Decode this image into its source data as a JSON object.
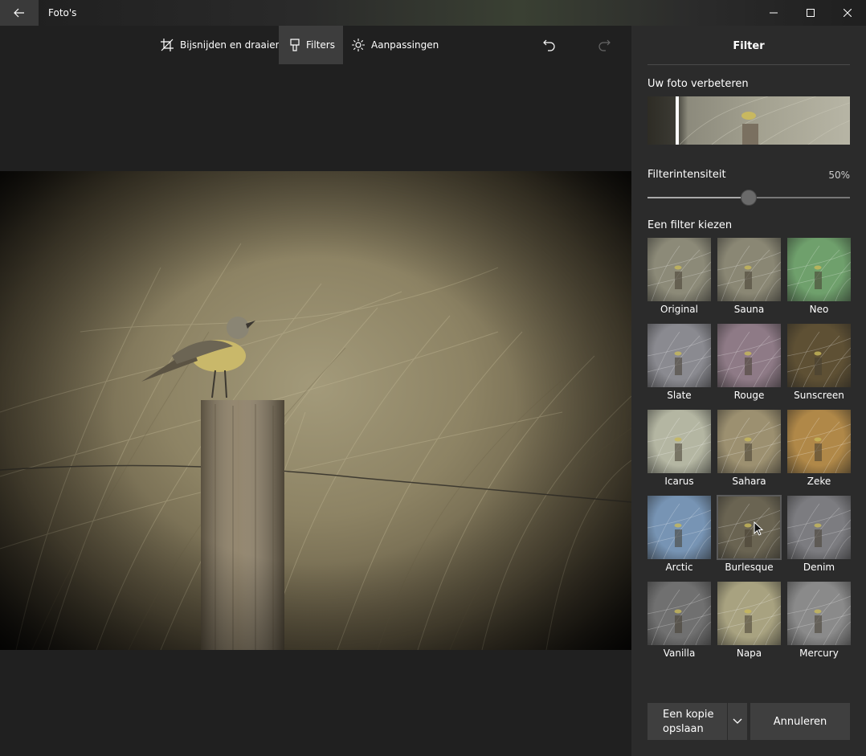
{
  "window": {
    "title": "Foto's"
  },
  "toolbar": {
    "crop_label": "Bijsnijden en draaien",
    "filters_label": "Filters",
    "adjust_label": "Aanpassingen"
  },
  "panel": {
    "title": "Filter",
    "enhance_label": "Uw foto verbeteren",
    "intensity_label": "Filterintensiteit",
    "intensity_value": "50%",
    "intensity_fraction": 0.5,
    "choose_label": "Een filter kiezen",
    "filters": [
      {
        "name": "Original",
        "tint": "#8c8a78"
      },
      {
        "name": "Sauna",
        "tint": "#8a8774"
      },
      {
        "name": "Neo",
        "tint": "#6fa06c"
      },
      {
        "name": "Slate",
        "tint": "#8a8a90"
      },
      {
        "name": "Rouge",
        "tint": "#8e7a86"
      },
      {
        "name": "Sunscreen",
        "tint": "#5e5034"
      },
      {
        "name": "Icarus",
        "tint": "#b4b6a2"
      },
      {
        "name": "Sahara",
        "tint": "#9c9070"
      },
      {
        "name": "Zeke",
        "tint": "#b08848"
      },
      {
        "name": "Arctic",
        "tint": "#7794b4"
      },
      {
        "name": "Burlesque",
        "tint": "#6a6452"
      },
      {
        "name": "Denim",
        "tint": "#7c7c80"
      },
      {
        "name": "Vanilla",
        "tint": "#707070"
      },
      {
        "name": "Napa",
        "tint": "#a8a280"
      },
      {
        "name": "Mercury",
        "tint": "#8a8a8a"
      }
    ],
    "selected_filter": "Burlesque",
    "save_label_line1": "Een kopie",
    "save_label_line2": "opslaan",
    "cancel_label": "Annuleren"
  }
}
